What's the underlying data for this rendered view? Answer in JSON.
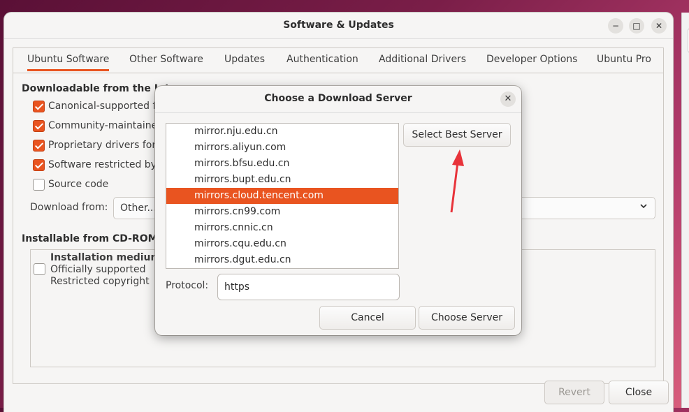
{
  "window": {
    "title": "Software & Updates",
    "controls": {
      "minimize": "−",
      "maximize": "□",
      "close": "✕"
    }
  },
  "tabs": [
    "Ubuntu Software",
    "Other Software",
    "Updates",
    "Authentication",
    "Additional Drivers",
    "Developer Options",
    "Ubuntu Pro"
  ],
  "downloadable": {
    "heading": "Downloadable from the Inte",
    "items": [
      {
        "label": "Canonical-supported fr",
        "checked": true
      },
      {
        "label": "Community-maintained",
        "checked": true
      },
      {
        "label": "Proprietary drivers for",
        "checked": true
      },
      {
        "label": "Software restricted by c",
        "checked": true
      },
      {
        "label": "Source code",
        "checked": false
      }
    ],
    "download_from_label": "Download from:",
    "download_from_value": "Other..."
  },
  "cdrom": {
    "heading": "Installable from CD-ROM/D",
    "medium_title": "Installation medium v",
    "lines": [
      "Officially supported",
      "Restricted copyright"
    ]
  },
  "footer": {
    "revert": "Revert",
    "close": "Close"
  },
  "dialog": {
    "title": "Choose a Download Server",
    "close_glyph": "✕",
    "servers": [
      "mirror.nju.edu.cn",
      "mirrors.aliyun.com",
      "mirrors.bfsu.edu.cn",
      "mirrors.bupt.edu.cn",
      "mirrors.cloud.tencent.com",
      "mirrors.cn99.com",
      "mirrors.cnnic.cn",
      "mirrors.cqu.edu.cn",
      "mirrors.dgut.edu.cn"
    ],
    "selected_server": "mirrors.cloud.tencent.com",
    "select_best": "Select Best Server",
    "protocol_label": "Protocol:",
    "protocol_value": "https",
    "cancel": "Cancel",
    "choose": "Choose Server"
  },
  "colors": {
    "accent": "#e95420",
    "annotation_arrow": "#e8333a"
  }
}
